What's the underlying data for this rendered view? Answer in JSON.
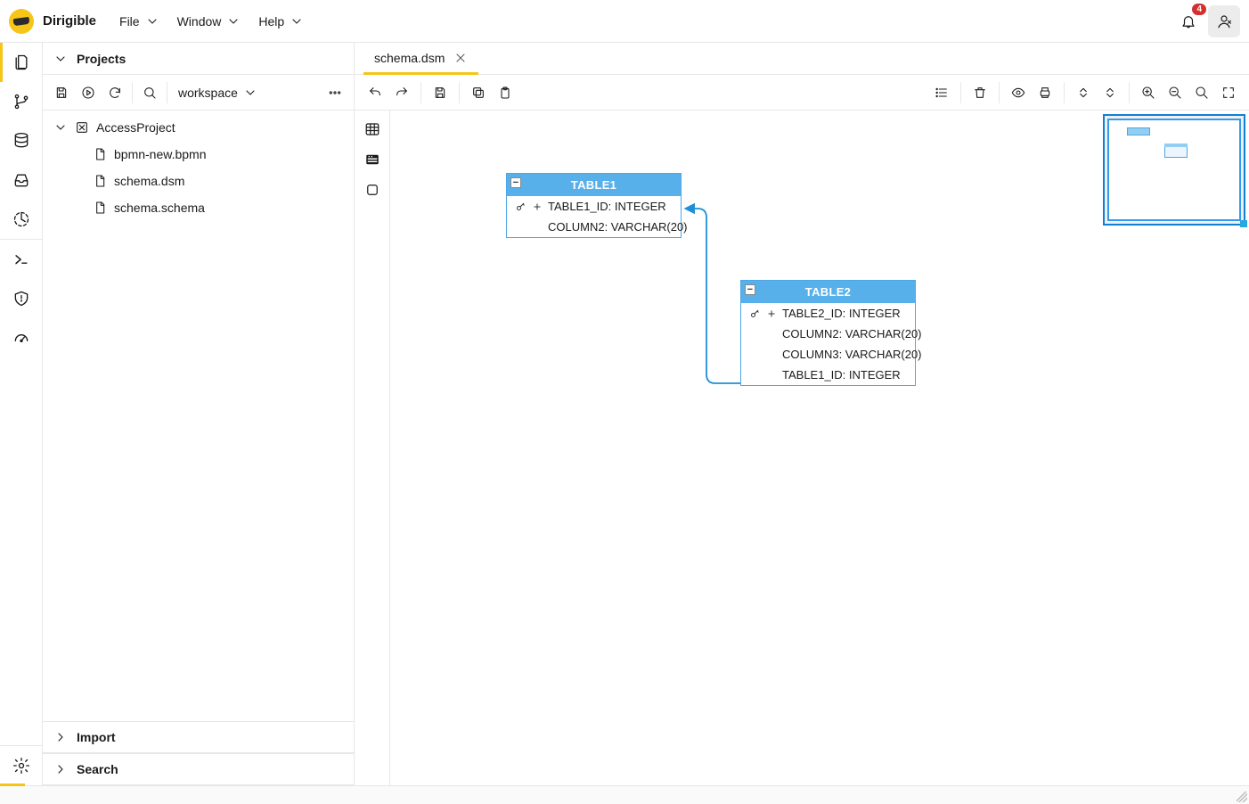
{
  "brand": "Dirigible",
  "menus": {
    "file": "File",
    "window": "Window",
    "help": "Help"
  },
  "notifications": {
    "count": "4"
  },
  "sidebar": {
    "projects": "Projects",
    "import": "Import",
    "search": "Search",
    "workspace": "workspace",
    "project": "AccessProject",
    "files": [
      "bpmn-new.bpmn",
      "schema.dsm",
      "schema.schema"
    ]
  },
  "editor": {
    "tab": "schema.dsm",
    "table1": {
      "name": "TABLE1",
      "rows": [
        "TABLE1_ID: INTEGER",
        "COLUMN2: VARCHAR(20)"
      ]
    },
    "table2": {
      "name": "TABLE2",
      "rows": [
        "TABLE2_ID: INTEGER",
        "COLUMN2: VARCHAR(20)",
        "COLUMN3: VARCHAR(20)",
        "TABLE1_ID: INTEGER"
      ]
    }
  }
}
